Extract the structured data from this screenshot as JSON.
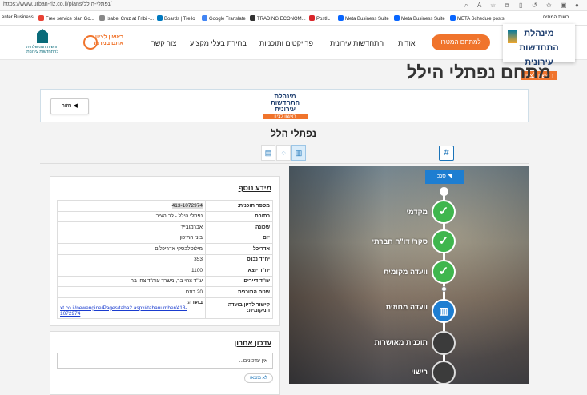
{
  "browser": {
    "url": "https://www.urban-rlz.co.il/plans/נפתלי-הילל/"
  },
  "bookmarks": [
    {
      "label": "enter Business...",
      "color": "#1a73e8"
    },
    {
      "label": "Free service plan Go...",
      "color": "#e94235"
    },
    {
      "label": "Isabel Cruz at Fribi -...",
      "color": "#888888"
    },
    {
      "label": "Boards | Trello",
      "color": "#0079bf"
    },
    {
      "label": "Google Translate",
      "color": "#4285f4"
    },
    {
      "label": "TRADING ECONOM...",
      "color": "#333333"
    },
    {
      "label": "PostIL",
      "color": "#d9262b"
    },
    {
      "label": "Meta Business Suite",
      "color": "#0866ff"
    },
    {
      "label": "Meta Business Suite",
      "color": "#0866ff"
    },
    {
      "label": "META Schedule posts",
      "color": "#0866ff"
    },
    {
      "label": "רשות המסים",
      "color": "#222222"
    }
  ],
  "header": {
    "logo_line1": "מינהלת",
    "logo_line2": "התחדשות",
    "logo_line3": "עירונית",
    "logo_city": "ראשון לציון",
    "nav": [
      "אודות",
      "התחדשות עירונית",
      "פרויקטים ותוכניות",
      "בחירת בעלי מקצוע",
      "צור קשר"
    ],
    "cta": "למתחם המטרו",
    "rl_logo_line1": "ראשון לציון",
    "rl_logo_line2": "אתם במרכז",
    "ha_logo_line1": "הרשות הממשלתית",
    "ha_logo_line2": "להתחדשות עירונית"
  },
  "page_title": "מתחם נפתלי הילל",
  "hero": {
    "back_label": "חזור",
    "logo_line1": "מינהלת",
    "logo_line2": "התחדשות עירונית",
    "logo_city": "ראשון לציון"
  },
  "sub_title": "נפתלי הלל",
  "hash_label": "#",
  "info": {
    "title": "מידע נוסף",
    "rows": [
      {
        "k": "מספר תוכנית:",
        "v": "413-1072974"
      },
      {
        "k": "כתובת",
        "v": "נפתלי הילל - לב העיר"
      },
      {
        "k": "שכונה",
        "v": "אברמוביץ'"
      },
      {
        "k": "יזם",
        "v": "בוני התיכון"
      },
      {
        "k": "אדריכל",
        "v": "מילוסלבסקי אדריכלים"
      },
      {
        "k": "יח\"ד נכנס",
        "v": "353"
      },
      {
        "k": "יח\"ד יוצא",
        "v": "1100"
      },
      {
        "k": "עו\"ד דיירים",
        "v": "עו\"ד צחי בר, משרד עוה\"ד צחי בר"
      },
      {
        "k": "שטח התוכנית",
        "v": "20 דונם"
      }
    ],
    "link_key": "קישור לדיון בועדה המקומית:",
    "link_label": "בועדה:",
    "link_url": "xt.co.il/newengine/Pages/taba2.aspx#tabanumber/413-1072974"
  },
  "update": {
    "title": "עדכון אחרון",
    "text": "אין עדכונים...",
    "more": "לא נמצאו"
  },
  "timeline": {
    "filter": "סנכ",
    "steps": [
      {
        "label": "מקדמי",
        "state": "done"
      },
      {
        "label": "סקר/ דו\"ח חברתי",
        "state": "done"
      },
      {
        "label": "וועדה מקומית",
        "state": "done"
      },
      {
        "label": "וועדה מחוזית",
        "state": "current"
      },
      {
        "label": "תוכנית מאושרות",
        "state": "todo"
      },
      {
        "label": "רישוי",
        "state": "todo"
      }
    ]
  }
}
